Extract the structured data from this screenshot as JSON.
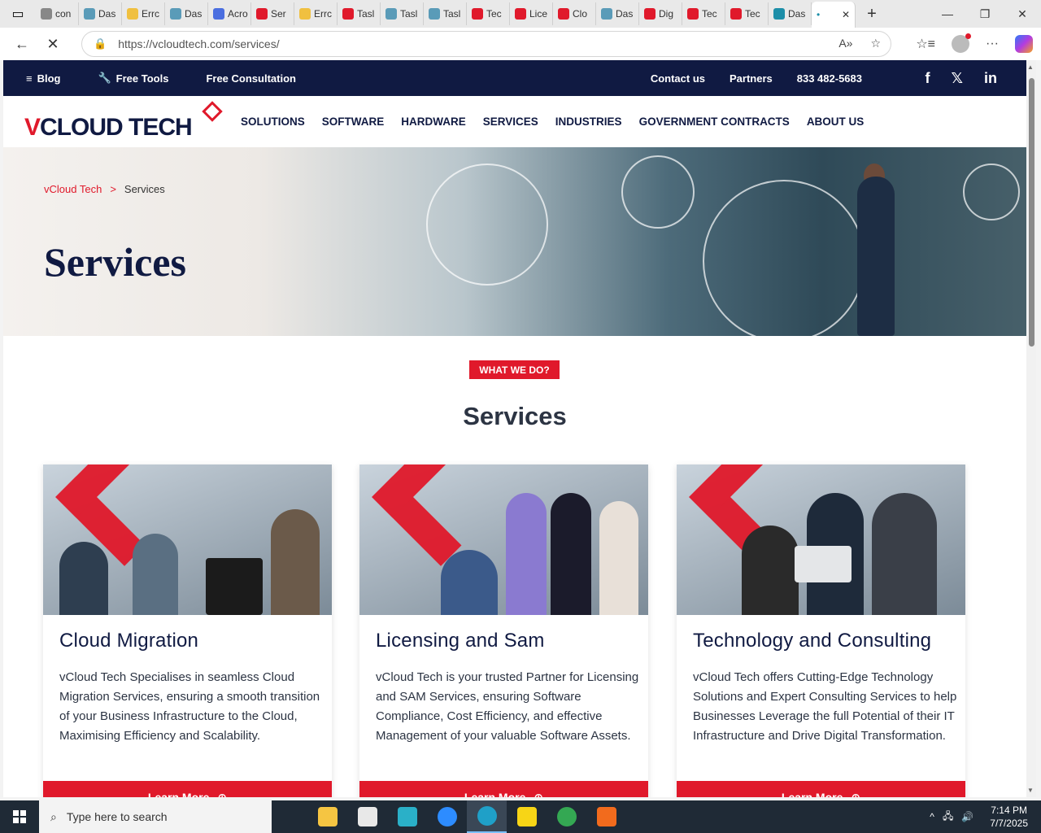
{
  "browser": {
    "tabs": [
      {
        "label": "con",
        "color": "#888888"
      },
      {
        "label": "Das",
        "color": "#5a9bb8"
      },
      {
        "label": "Errc",
        "color": "#f0c040"
      },
      {
        "label": "Das",
        "color": "#5a9bb8"
      },
      {
        "label": "Acro",
        "color": "#4a6ee0"
      },
      {
        "label": "Ser",
        "color": "#e0192b"
      },
      {
        "label": "Errc",
        "color": "#f0c040"
      },
      {
        "label": "Tasl",
        "color": "#e0192b"
      },
      {
        "label": "Tasl",
        "color": "#5a9bb8"
      },
      {
        "label": "Tasl",
        "color": "#5a9bb8"
      },
      {
        "label": "Tec",
        "color": "#e0192b"
      },
      {
        "label": "Lice",
        "color": "#e0192b"
      },
      {
        "label": "Clo",
        "color": "#e0192b"
      },
      {
        "label": "Das",
        "color": "#5a9bb8"
      },
      {
        "label": "Dig",
        "color": "#e0192b"
      },
      {
        "label": "Tec",
        "color": "#e0192b"
      },
      {
        "label": "Tec",
        "color": "#e0192b"
      },
      {
        "label": "Das",
        "color": "#1c8ea8"
      }
    ],
    "url": "https://vcloudtech.com/services/"
  },
  "topbar": {
    "blog": "Blog",
    "free_tools": "Free Tools",
    "free_consultation": "Free Consultation",
    "contact": "Contact us",
    "partners": "Partners",
    "phone": "833 482-5683"
  },
  "logo": {
    "v": "V",
    "text": "CLOUD TECH"
  },
  "nav": [
    "SOLUTIONS",
    "SOFTWARE",
    "HARDWARE",
    "SERVICES",
    "INDUSTRIES",
    "GOVERNMENT CONTRACTS",
    "ABOUT US"
  ],
  "breadcrumb": {
    "home": "vCloud Tech",
    "sep": ">",
    "current": "Services"
  },
  "hero_title": "Services",
  "badge": "WHAT WE DO?",
  "section_title": "Services",
  "cards": [
    {
      "title": "Cloud Migration",
      "desc": "vCloud Tech Specialises in seamless Cloud Migration Services, ensuring a smooth transition of your Business Infrastructure to the Cloud, Maximising Efficiency and Scalability.",
      "btn": "Learn More"
    },
    {
      "title": "Licensing and Sam",
      "desc": "vCloud Tech is your trusted Partner for Licensing and SAM Services, ensuring Software Compliance, Cost Efficiency, and effective Management of your valuable Software Assets.",
      "btn": "Learn More"
    },
    {
      "title": "Technology and Consulting",
      "desc": "vCloud Tech offers Cutting-Edge Technology Solutions and Expert Consulting Services to help Businesses Leverage the full Potential of their IT Infrastructure and Drive Digital Transformation.",
      "btn": "Learn More"
    }
  ],
  "taskbar": {
    "search_placeholder": "Type here to search",
    "apps": [
      {
        "name": "file-explorer",
        "color": "#f5c542"
      },
      {
        "name": "paint",
        "color": "#e8e8e8"
      },
      {
        "name": "app-diamond",
        "color": "#2ab0c8"
      },
      {
        "name": "zoom",
        "color": "#2d8cff"
      },
      {
        "name": "edge",
        "color": "#1fa0c8"
      },
      {
        "name": "sticky-notes",
        "color": "#f7d516"
      },
      {
        "name": "chrome",
        "color": "#34a853"
      },
      {
        "name": "xampp",
        "color": "#f26b1d"
      }
    ],
    "time": "7:14 PM",
    "date": "7/7/2025"
  }
}
